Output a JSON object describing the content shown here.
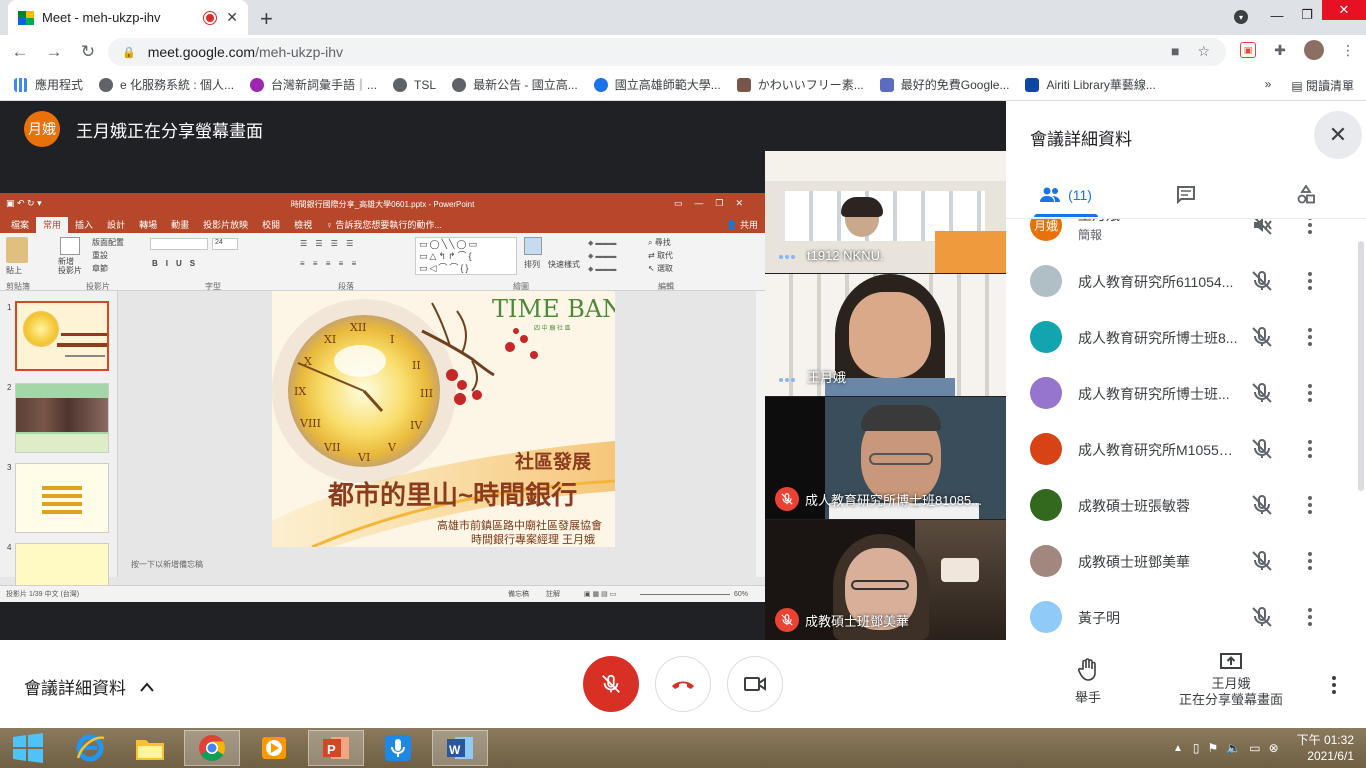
{
  "browser": {
    "tab_title": "Meet - meh-ukzp-ihv",
    "url_host": "meet.google.com",
    "url_path": "/meh-ukzp-ihv",
    "bookmarks": [
      {
        "label": "應用程式",
        "color": "#4285f4"
      },
      {
        "label": "e 化服務系統 : 個人...",
        "color": "#5f6368"
      },
      {
        "label": "台灣新詞彙手語｜...",
        "color": "#9c27b0"
      },
      {
        "label": "TSL",
        "color": "#5f6368"
      },
      {
        "label": "最新公告 - 國立高...",
        "color": "#5f6368"
      },
      {
        "label": "國立高雄師範大學...",
        "color": "#1a73e8"
      },
      {
        "label": "かわいいフリー素...",
        "color": "#795548"
      },
      {
        "label": "最好的免費Google...",
        "color": "#5c6bc0"
      },
      {
        "label": "Airiti Library華藝線...",
        "color": "#0d47a1"
      }
    ],
    "overflow": "»",
    "reading_list": "閱讀清單"
  },
  "stage": {
    "presenter_initials": "月娥",
    "presenter_banner": "王月娥正在分享螢幕畫面"
  },
  "ppt": {
    "window_title": "時間銀行國際分享_高雄大學0601.pptx - PowerPoint",
    "tabs": [
      "檔案",
      "常用",
      "插入",
      "設計",
      "轉場",
      "動畫",
      "投影片放映",
      "校閱",
      "檢視",
      "♀ 告訴我您想要執行的動作..."
    ],
    "share": "共用",
    "ribbon_groups": [
      "剪貼簿",
      "投影片",
      "字型",
      "段落",
      "繪圖",
      "編輯"
    ],
    "ribbon_items": {
      "paste": "貼上",
      "new_slide": "新增\n投影片",
      "layout": "版面配置",
      "reset": "重設",
      "section": "章節",
      "arrange": "排列",
      "quick_styles": "快速樣式",
      "find": "尋找",
      "replace": "取代",
      "select": "選取",
      "font_size": "24"
    },
    "slide_numbers": [
      "1",
      "2",
      "3",
      "4"
    ],
    "slide": {
      "logo": "TIME BANK",
      "logo_sub": "四  中  廟  社  區",
      "subtitle": "社區發展",
      "title": "都市的里山~時間銀行",
      "org": "高雄市前鎮區路中廟社區發展協會",
      "presenter": "時間銀行專案經理  王月娥"
    },
    "notes": "按一下以新增備忘稿",
    "status_left": "投影片 1/39   中文 (台灣)",
    "status_notes": "備忘稿",
    "status_comments": "註解",
    "zoom": "60%"
  },
  "tiles": [
    {
      "name": "t1912 NKNU.",
      "muted": false
    },
    {
      "name": "王月娥",
      "muted": false
    },
    {
      "name": "成人教育研究所博士班81085...",
      "muted": true
    },
    {
      "name": "成教碩士班鄧美華",
      "muted": true
    }
  ],
  "panel": {
    "title": "會議詳細資料",
    "people_count": "(11)",
    "participants": [
      {
        "name": "王月娥",
        "sub": "簡報",
        "avatar": "月娥",
        "color": "#e8710a"
      },
      {
        "name": "成人教育研究所611054...",
        "avatar": "",
        "color": "#b0bec5"
      },
      {
        "name": "成人教育研究所博士班8...",
        "avatar": "",
        "color": "#12a4af"
      },
      {
        "name": "成人教育研究所博士班...",
        "avatar": "",
        "color": "#9575cd"
      },
      {
        "name": "成人教育研究所M10556...",
        "avatar": "",
        "color": "#d84315"
      },
      {
        "name": "成教碩士班張敏蓉",
        "avatar": "",
        "color": "#33691e"
      },
      {
        "name": "成教碩士班鄧美華",
        "avatar": "",
        "color": "#a1887f"
      },
      {
        "name": "黃子明",
        "avatar": "",
        "color": "#90caf9"
      }
    ]
  },
  "bottom": {
    "meeting_details": "會議詳細資料",
    "raise_hand": "舉手",
    "share_name": "王月娥",
    "share_status": "正在分享螢幕畫面"
  },
  "taskbar": {
    "time_period": "下午 01:32",
    "date": "2021/6/1"
  }
}
